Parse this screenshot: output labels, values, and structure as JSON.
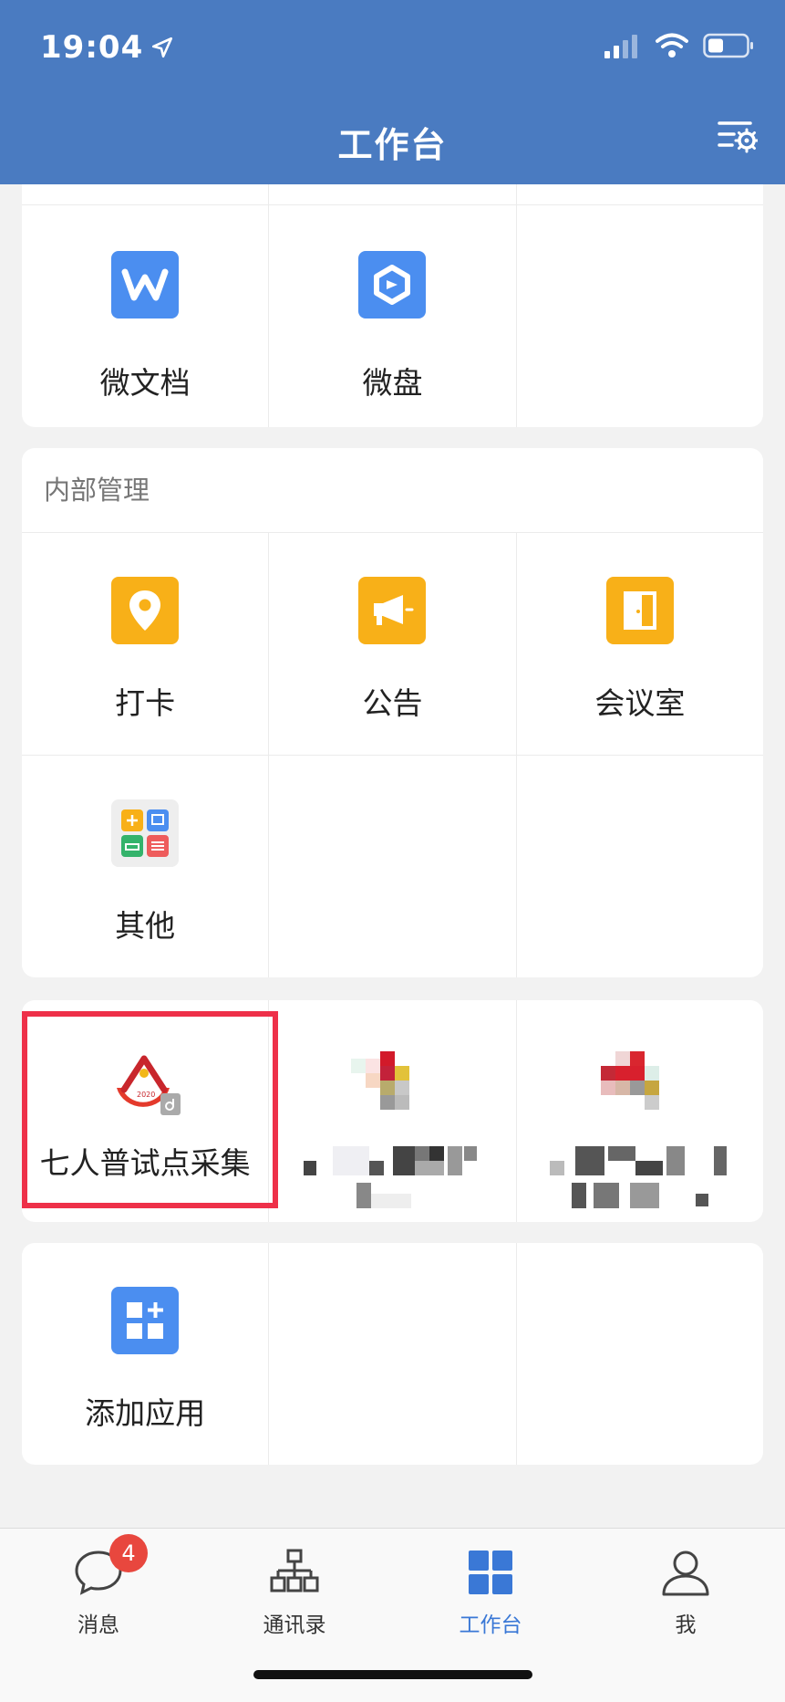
{
  "status_bar": {
    "time": "19:04"
  },
  "header": {
    "title": "工作台"
  },
  "docs_card": {
    "items": [
      {
        "label": "微文档",
        "icon": "w-doc-icon",
        "color": "#4b8ef0"
      },
      {
        "label": "微盘",
        "icon": "cloud-drive-icon",
        "color": "#4b8ef0"
      }
    ]
  },
  "internal_card": {
    "title": "内部管理",
    "items": [
      {
        "label": "打卡",
        "icon": "location-pin-icon",
        "color": "#f8b018"
      },
      {
        "label": "公告",
        "icon": "megaphone-icon",
        "color": "#f8b018"
      },
      {
        "label": "会议室",
        "icon": "door-icon",
        "color": "#f8b018"
      },
      {
        "label": "其他",
        "icon": "app-grid-icon",
        "color": "#eeeeee"
      }
    ]
  },
  "apps_card": {
    "items": [
      {
        "label": "七人普试点采集",
        "icon": "census-2020-icon"
      }
    ]
  },
  "add_card": {
    "items": [
      {
        "label": "添加应用",
        "icon": "add-app-icon",
        "color": "#4b8ef0"
      }
    ]
  },
  "tabbar": {
    "tabs": [
      {
        "label": "消息",
        "icon": "message-icon",
        "badge": "4"
      },
      {
        "label": "通讯录",
        "icon": "org-chart-icon"
      },
      {
        "label": "工作台",
        "icon": "workbench-icon",
        "active": true
      },
      {
        "label": "我",
        "icon": "profile-icon"
      }
    ]
  },
  "colors": {
    "header": "#4a7bc1",
    "accent": "#3a78d6",
    "highlight": "#ee3049",
    "badge": "#e8473e"
  }
}
